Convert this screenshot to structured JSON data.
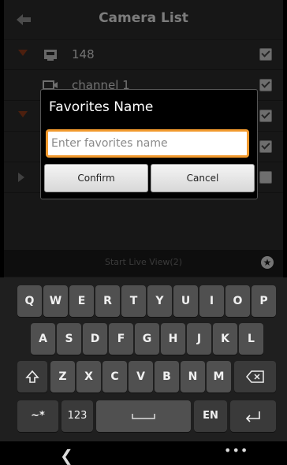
{
  "app": {
    "title": "Camera List"
  },
  "list": {
    "rows": [
      {
        "label": "148",
        "icon": "device-icon",
        "caret": "down",
        "checked": true
      },
      {
        "label": "channel 1",
        "icon": "camera-icon",
        "caret": "none",
        "checked": true
      },
      {
        "label": "",
        "icon": "",
        "caret": "down",
        "checked": true
      },
      {
        "label": "",
        "icon": "",
        "caret": "none",
        "checked": true
      },
      {
        "label": "",
        "icon": "",
        "caret": "right",
        "checked": false
      }
    ]
  },
  "start_bar": {
    "label": "Start Live View(2)"
  },
  "dialog": {
    "title": "Favorites Name",
    "input_value": "",
    "input_placeholder": "Enter favorites name",
    "confirm_label": "Confirm",
    "cancel_label": "Cancel"
  },
  "keyboard": {
    "row1": [
      "Q",
      "W",
      "E",
      "R",
      "T",
      "Y",
      "U",
      "I",
      "O",
      "P"
    ],
    "row2": [
      "A",
      "S",
      "D",
      "F",
      "G",
      "H",
      "J",
      "K",
      "L"
    ],
    "row3": [
      "Z",
      "X",
      "C",
      "V",
      "B",
      "N",
      "M"
    ],
    "shift_icon": "shift-icon",
    "backspace_icon": "backspace-icon",
    "symbols_label": "~*",
    "numbers_label": "123",
    "space_icon": "space-icon",
    "language_label": "EN",
    "enter_icon": "enter-icon"
  },
  "navbar": {
    "back_icon": "nav-back-icon",
    "more_icon": "more-icon"
  },
  "colors": {
    "accent": "#f29a2e",
    "background": "#2a2a2a"
  }
}
